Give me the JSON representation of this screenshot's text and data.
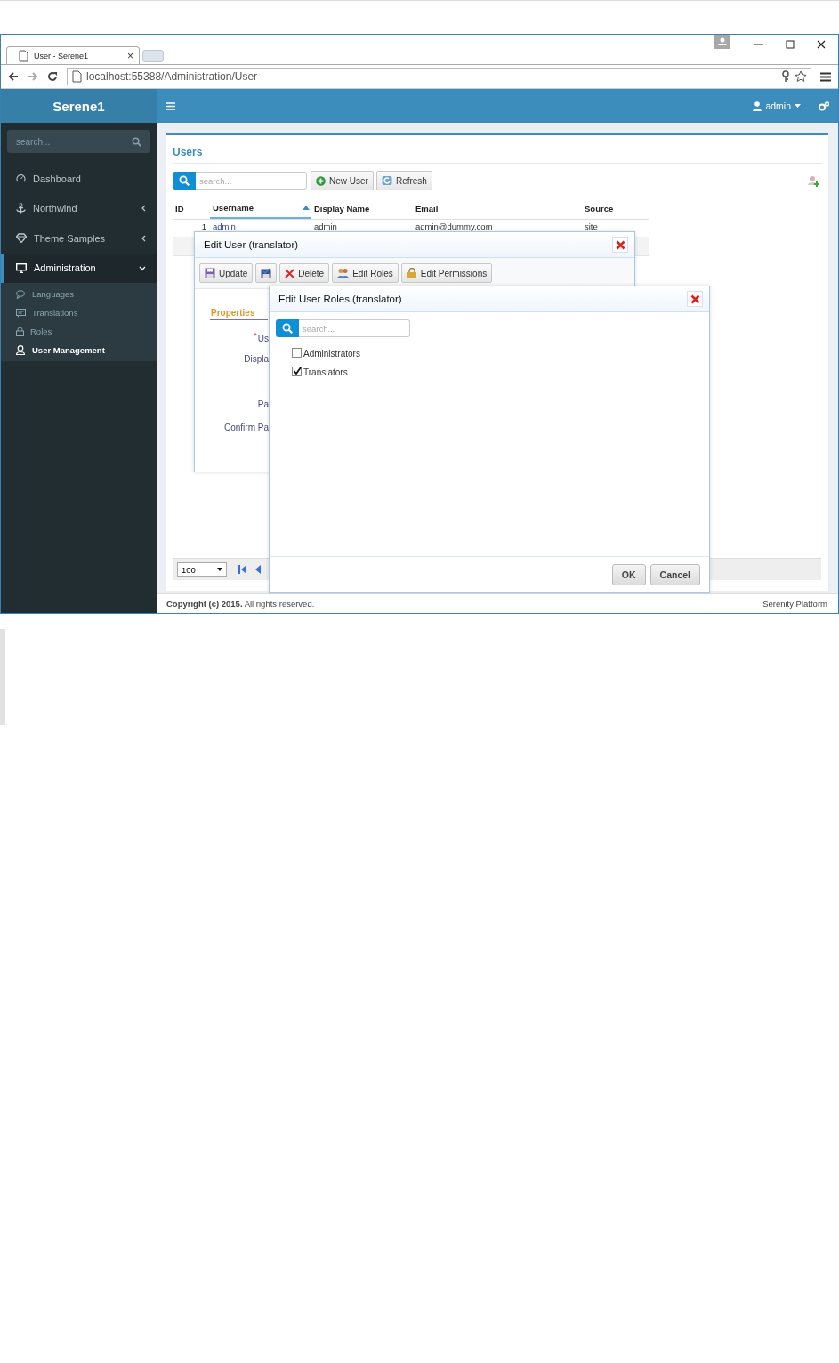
{
  "browser": {
    "tab": {
      "title": "User - Serene1",
      "close": "×"
    },
    "url": "localhost:55388/Administration/User"
  },
  "app": {
    "logo": "Serene1",
    "user": "admin"
  },
  "sidebar": {
    "search": {
      "placeholder": "search..."
    },
    "items": [
      {
        "label": "Dashboard",
        "kind": "link",
        "selected": false
      },
      {
        "label": "Northwind",
        "kind": "group",
        "expanded": false,
        "selected": false
      },
      {
        "label": "Theme Samples",
        "kind": "group",
        "expanded": false,
        "selected": false
      },
      {
        "label": "Administration",
        "kind": "group",
        "expanded": true,
        "selected": true,
        "children": [
          {
            "label": "Languages",
            "selected": false
          },
          {
            "label": "Translations",
            "selected": false
          },
          {
            "label": "Roles",
            "selected": false
          },
          {
            "label": "User Management",
            "selected": true
          }
        ]
      }
    ]
  },
  "panel": {
    "title": "Users",
    "search": {
      "placeholder": "search..."
    },
    "buttons": [
      {
        "label": "New User",
        "kind": "add"
      },
      {
        "label": "Refresh",
        "kind": "refresh"
      }
    ]
  },
  "table": {
    "columns": [
      {
        "label": "ID",
        "sorted": false
      },
      {
        "label": "Username",
        "sorted": true
      },
      {
        "label": "Display Name",
        "sorted": false
      },
      {
        "label": "Email",
        "sorted": false
      },
      {
        "label": "Source",
        "sorted": false
      }
    ],
    "rows": [
      {
        "cells": [
          "1",
          "admin",
          "admin",
          "admin@dummy.com",
          "site"
        ],
        "selected": false
      }
    ]
  },
  "pager": {
    "page_size": "100"
  },
  "edit_user_dialog": {
    "title": "Edit User (translator)",
    "buttons": [
      {
        "label": "Update",
        "kind": "update"
      },
      {
        "kind": "apply"
      },
      {
        "label": "Delete",
        "kind": "delete"
      },
      {
        "label": "Edit Roles",
        "kind": "roles"
      },
      {
        "label": "Edit Permissions",
        "kind": "permissions"
      }
    ],
    "tabs": [
      {
        "label": "Properties",
        "selected": true
      }
    ],
    "required_mark": "*",
    "fields": [
      {
        "label": "Us",
        "required": true
      },
      {
        "label": "Displa",
        "required": false
      },
      {
        "label": "Pa",
        "required": false
      },
      {
        "label": "Confirm Pa",
        "required": false
      }
    ]
  },
  "roles_dialog": {
    "title": "Edit User Roles (translator)",
    "search": {
      "placeholder": "search..."
    },
    "roles": [
      {
        "label": "Administrators",
        "checked": false
      },
      {
        "label": "Translators",
        "checked": true
      }
    ],
    "buttons": [
      "OK",
      "Cancel"
    ]
  },
  "footer": {
    "copyright": "**Copyright (c) 2015.** All rights reserved.",
    "brand": "Serenity Platform"
  }
}
